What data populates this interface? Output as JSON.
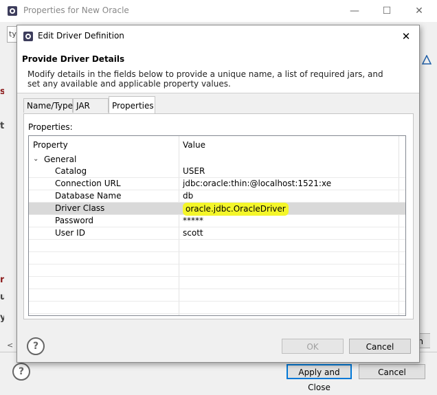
{
  "background_window": {
    "title": "Properties for New Oracle",
    "filter_text": "ty",
    "left_edge_letters": [
      "s",
      "t",
      "r",
      "u",
      "y"
    ],
    "right_edge_button_text": "on",
    "apply_close_label": "Apply and Close",
    "cancel_label": "Cancel",
    "minimize_glyph": "—",
    "maximize_glyph": "☐",
    "close_glyph": "✕",
    "help_glyph": "?"
  },
  "dialog": {
    "title": "Edit Driver Definition",
    "close_glyph": "✕",
    "header_title": "Provide Driver Details",
    "header_description": "Modify details in the fields below to provide a unique name, a list of required jars, and set any available and applicable property values.",
    "tabs": [
      {
        "label": "Name/Type",
        "active": false
      },
      {
        "label": "JAR List",
        "active": false
      },
      {
        "label": "Properties",
        "active": true
      }
    ],
    "panel_label": "Properties:",
    "columns": {
      "property": "Property",
      "value": "Value"
    },
    "group": {
      "label": "General",
      "expanded": true,
      "chevron": "⌄"
    },
    "rows": [
      {
        "property": "Catalog",
        "value": "USER",
        "selected": false
      },
      {
        "property": "Connection URL",
        "value": "jdbc:oracle:thin:@localhost:1521:xe",
        "selected": false
      },
      {
        "property": "Database Name",
        "value": "db",
        "selected": false
      },
      {
        "property": "Driver Class",
        "value": "oracle.jdbc.OracleDriver",
        "selected": true
      },
      {
        "property": "Password",
        "value": "*****",
        "selected": false
      },
      {
        "property": "User ID",
        "value": "scott",
        "selected": false
      }
    ],
    "ok_label": "OK",
    "cancel_label": "Cancel",
    "help_glyph": "?"
  },
  "colors": {
    "highlight": "#f4f62a",
    "selected_row": "#d9d9d9",
    "default_button_border": "#0078d7"
  }
}
